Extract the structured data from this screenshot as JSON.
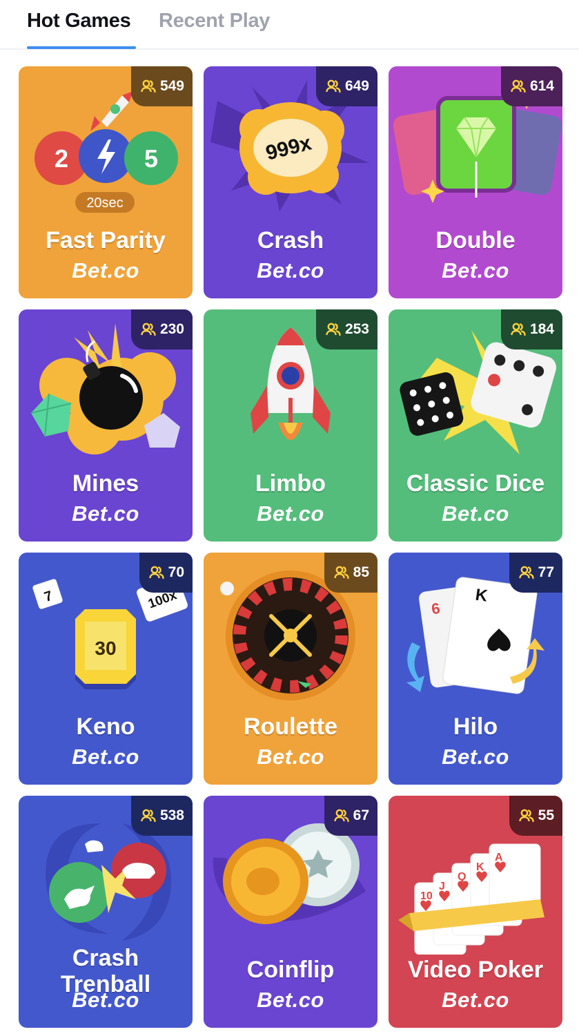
{
  "tabs": [
    {
      "label": "Hot Games",
      "active": true
    },
    {
      "label": "Recent Play",
      "active": false
    }
  ],
  "brand_text": "Bet.co",
  "games": [
    {
      "title": "Fast Parity",
      "players": "549",
      "bg": "#f0a33a",
      "badge_bg": "#6b4a1e",
      "art": "fast-parity",
      "balls": [
        "2",
        "5"
      ],
      "timer": "20sec"
    },
    {
      "title": "Crash",
      "players": "649",
      "bg": "#6a45d1",
      "badge_bg": "#2e2366",
      "art": "crash",
      "multiplier": "999x"
    },
    {
      "title": "Double",
      "players": "614",
      "bg": "#b24ad0",
      "badge_bg": "#4c2159",
      "art": "double"
    },
    {
      "title": "Mines",
      "players": "230",
      "bg": "#6a45d1",
      "badge_bg": "#2e2366",
      "art": "mines"
    },
    {
      "title": "Limbo",
      "players": "253",
      "bg": "#54bd7b",
      "badge_bg": "#1f4c31",
      "art": "limbo"
    },
    {
      "title": "Classic Dice",
      "players": "184",
      "bg": "#54bd7b",
      "badge_bg": "#1f4c31",
      "art": "dice"
    },
    {
      "title": "Keno",
      "players": "70",
      "bg": "#4458cd",
      "badge_bg": "#1e2860",
      "art": "keno",
      "keno_numbers": [
        "7",
        "30",
        "100x"
      ]
    },
    {
      "title": "Roulette",
      "players": "85",
      "bg": "#f0a33a",
      "badge_bg": "#6b4a1e",
      "art": "roulette"
    },
    {
      "title": "Hilo",
      "players": "77",
      "bg": "#4458cd",
      "badge_bg": "#1e2860",
      "art": "hilo",
      "cards": [
        "6",
        "K"
      ]
    },
    {
      "title": "Crash Trenball",
      "players": "538",
      "bg": "#4458cd",
      "badge_bg": "#1e2860",
      "art": "trenball"
    },
    {
      "title": "Coinflip",
      "players": "67",
      "bg": "#6a45d1",
      "badge_bg": "#2e2366",
      "art": "coinflip"
    },
    {
      "title": "Video Poker",
      "players": "55",
      "bg": "#d34552",
      "badge_bg": "#5c1e24",
      "art": "poker",
      "cards": [
        "10",
        "J",
        "Q",
        "K",
        "A"
      ]
    }
  ]
}
